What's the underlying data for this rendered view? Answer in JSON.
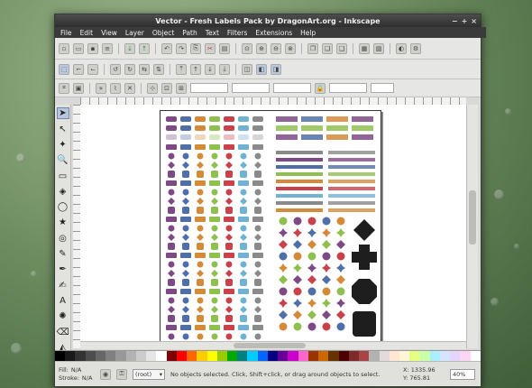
{
  "window": {
    "title": "Vector - Fresh Labels Pack by DragonArt.org - Inkscape",
    "controls": [
      "−",
      "+",
      "×"
    ]
  },
  "menu": [
    "File",
    "Edit",
    "View",
    "Layer",
    "Object",
    "Path",
    "Text",
    "Filters",
    "Extensions",
    "Help"
  ],
  "toolbox": {
    "icons": [
      "selector-arrow-icon",
      "node-tool-icon",
      "tweak-tool-icon",
      "zoom-tool-icon",
      "rectangle-tool-icon",
      "box-3d-tool-icon",
      "ellipse-tool-icon",
      "star-tool-icon",
      "spiral-tool-icon",
      "pencil-tool-icon",
      "pen-tool-icon",
      "calligraphy-tool-icon",
      "text-tool-icon",
      "spray-tool-icon",
      "eraser-tool-icon",
      "bucket-fill-icon"
    ]
  },
  "palette": [
    "#000000",
    "#1a1a1a",
    "#333333",
    "#4d4d4d",
    "#666666",
    "#808080",
    "#999999",
    "#b3b3b3",
    "#cccccc",
    "#e6e6e6",
    "#ffffff",
    "#800000",
    "#ff0000",
    "#ff6600",
    "#ffcc00",
    "#ffff00",
    "#99cc00",
    "#00aa00",
    "#008080",
    "#00ccff",
    "#0066ff",
    "#000080",
    "#660099",
    "#cc00cc",
    "#ff66cc",
    "#993300",
    "#cc6600",
    "#663300",
    "#4d0000",
    "#7f2a2a",
    "#aa4444",
    "#b3b3b3",
    "#e3dbdb",
    "#ffe6d5",
    "#fff6d5",
    "#e5ff80",
    "#ccffaa",
    "#aaeeff",
    "#d5e5ff",
    "#e5d5ff",
    "#ffd5f6",
    "#ffffff"
  ],
  "status": {
    "fill_label": "Fill:",
    "fill_value": "N/A",
    "stroke_label": "Stroke:",
    "stroke_value": "N/A",
    "layer": "(root)",
    "message": "No objects selected. Click, Shift+click, or drag around objects to select.",
    "x": "X: 1335.96",
    "y": "Y: 765.81",
    "zoom": "40%"
  },
  "colors": {
    "purple": "#7e4a86",
    "blue": "#4f6fa8",
    "orange": "#d58a3a",
    "green": "#8fbf4f",
    "red": "#c8414b",
    "lightblue": "#6fb2d4",
    "grey": "#8a8a8a",
    "black": "#1e1e1e"
  }
}
